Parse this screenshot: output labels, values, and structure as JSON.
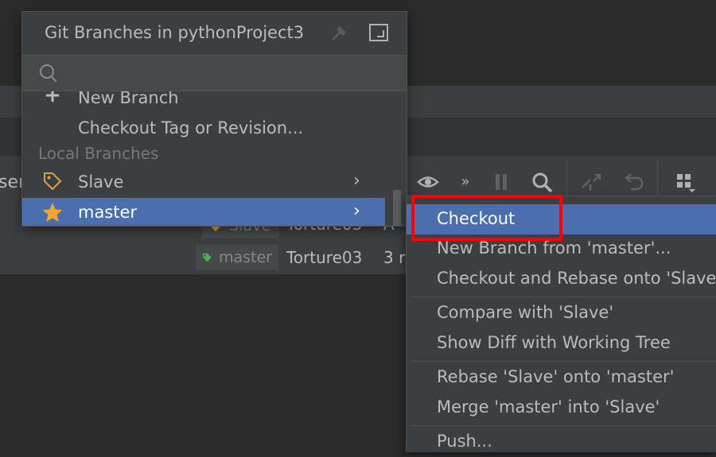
{
  "popup": {
    "title": "Git Branches in pythonProject3",
    "search_placeholder": "",
    "items": [
      {
        "label": "New Branch",
        "icon": "plus-icon"
      },
      {
        "label": "Checkout Tag or Revision...",
        "icon": ""
      }
    ],
    "section_header": "Local Branches",
    "branches": [
      {
        "label": "Slave",
        "icon": "tag-icon",
        "selected": false
      },
      {
        "label": "master",
        "icon": "star-icon",
        "selected": true
      }
    ]
  },
  "submenu": {
    "items": [
      {
        "label": "Checkout",
        "selected": true
      },
      {
        "label": "New Branch from 'master'..."
      },
      {
        "label": "Checkout and Rebase onto 'Slave'"
      },
      {
        "label": "Compare with 'Slave'"
      },
      {
        "label": "Show Diff with Working Tree"
      },
      {
        "label": "Rebase 'Slave' onto 'master'"
      },
      {
        "label": "Merge 'master' into 'Slave'"
      },
      {
        "label": "Push..."
      }
    ]
  },
  "background": {
    "partial_text": "ser",
    "log_rows": [
      {
        "ref": "Slave",
        "author": "Torture03",
        "date": "A"
      },
      {
        "ref": "master",
        "author": "Torture03",
        "date": "3 r"
      }
    ]
  },
  "colors": {
    "selection": "#4b6eaf",
    "highlight": "#ff0000",
    "star": "#f0a732",
    "tag_outline": "#d9a343",
    "tag_green": "#3fb950"
  }
}
